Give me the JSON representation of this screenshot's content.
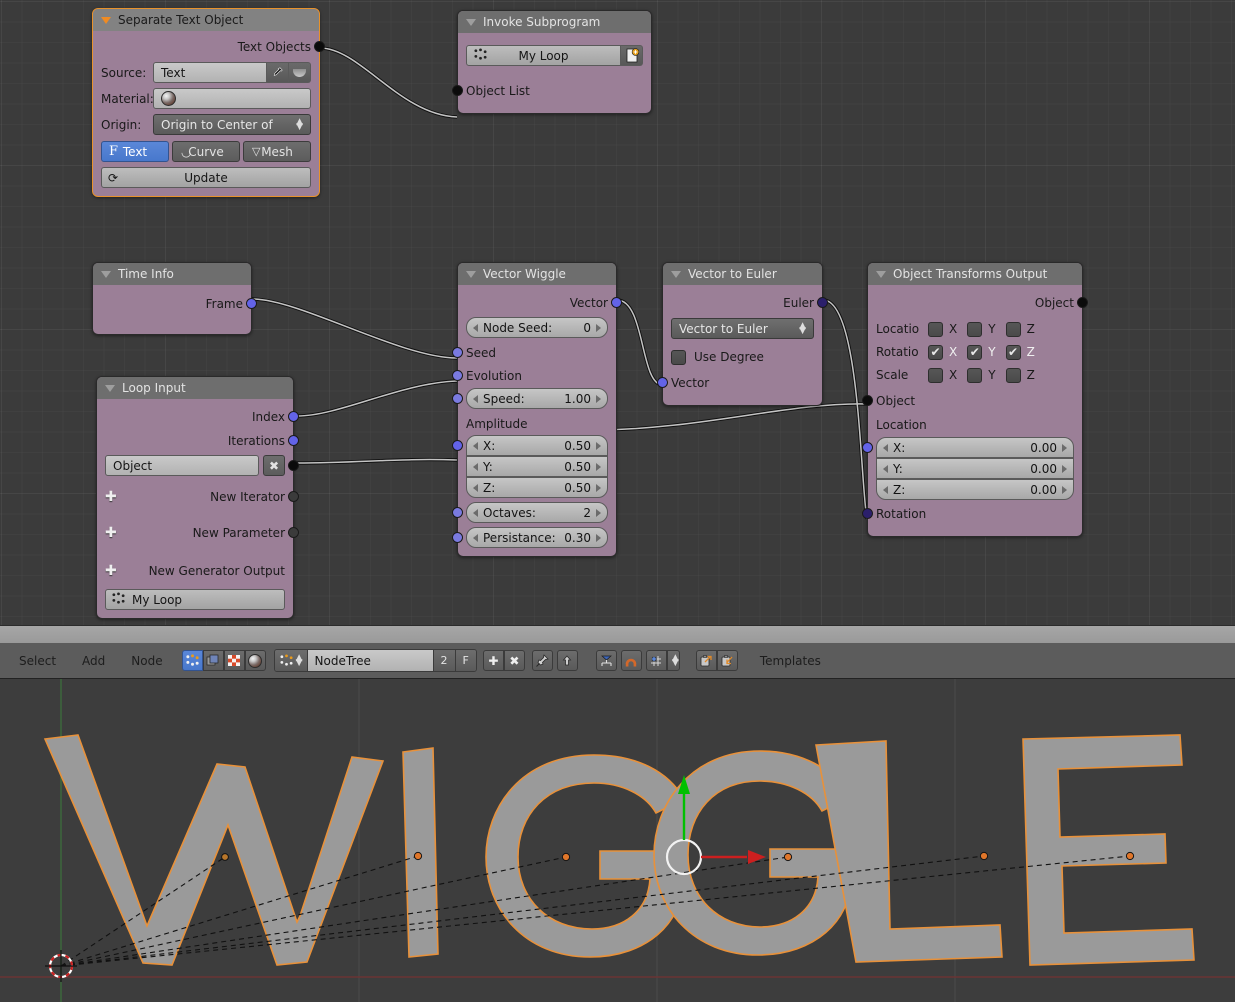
{
  "app": {
    "editor": "node-editor",
    "viewport": "3d-viewport"
  },
  "nodes": {
    "separate_text": {
      "title": "Separate Text Object",
      "output_label": "Text Objects",
      "source_label": "Source:",
      "source_value": "Text",
      "material_label": "Material:",
      "origin_label": "Origin:",
      "origin_value": "Origin to Center of",
      "mode_text": "Text",
      "mode_curve": "Curve",
      "mode_mesh": "Mesh",
      "update_label": "Update",
      "active": true
    },
    "invoke_subprogram": {
      "title": "Invoke Subprogram",
      "subprogram": "My Loop",
      "input_label": "Object List"
    },
    "time_info": {
      "title": "Time Info",
      "output_label": "Frame"
    },
    "loop_input": {
      "title": "Loop Input",
      "index_label": "Index",
      "iterations_label": "Iterations",
      "object_field": "Object",
      "new_iterator_label": "New Iterator",
      "new_parameter_label": "New Parameter",
      "new_generator_label": "New Generator Output",
      "subprogram": "My Loop"
    },
    "vector_wiggle": {
      "title": "Vector Wiggle",
      "output_label": "Vector",
      "node_seed_label": "Node Seed:",
      "node_seed_value": "0",
      "seed_label": "Seed",
      "evolution_label": "Evolution",
      "speed_label": "Speed:",
      "speed_value": "1.00",
      "amplitude_label": "Amplitude",
      "amp_x_label": "X:",
      "amp_x_value": "0.50",
      "amp_y_label": "Y:",
      "amp_y_value": "0.50",
      "amp_z_label": "Z:",
      "amp_z_value": "0.50",
      "octaves_label": "Octaves:",
      "octaves_value": "2",
      "persistance_label": "Persistance:",
      "persistance_value": "0.30"
    },
    "vector_to_euler": {
      "title": "Vector to Euler",
      "output_label": "Euler",
      "mode_value": "Vector to Euler",
      "use_degree_label": "Use Degree",
      "use_degree_checked": false,
      "input_label": "Vector"
    },
    "object_transforms_output": {
      "title": "Object Transforms Output",
      "output_label": "Object",
      "location_row_label": "Locatio",
      "rotation_row_label": "Rotatio",
      "scale_row_label": "Scale",
      "axis_x": "X",
      "axis_y": "Y",
      "axis_z": "Z",
      "loc_checks": [
        false,
        false,
        false
      ],
      "rot_checks": [
        true,
        true,
        true
      ],
      "scale_checks": [
        false,
        false,
        false
      ],
      "object_input_label": "Object",
      "location_label": "Location",
      "loc_x_label": "X:",
      "loc_x_value": "0.00",
      "loc_y_label": "Y:",
      "loc_y_value": "0.00",
      "loc_z_label": "Z:",
      "loc_z_value": "0.00",
      "rotation_input_label": "Rotation"
    }
  },
  "header": {
    "menus": [
      "Select",
      "Add",
      "Node"
    ],
    "icons": [
      "node-select-icon",
      "node-copy-icon",
      "node-overlay-icon",
      "node-shading-icon"
    ],
    "id_icon": "nodetree-icon",
    "id_name": "NodeTree",
    "users_count": "2",
    "fake_user": "F",
    "new_icon": "plus-icon",
    "unlink_icon": "cross-icon",
    "pin_icon": "pin-icon",
    "parent_icon": "up-arrow-icon",
    "tool_icons": [
      "auto-offset-icon",
      "snap-magnet-icon",
      "snap-grid-icon"
    ],
    "io_icons": [
      "export-icon",
      "import-icon"
    ],
    "templates_label": "Templates"
  },
  "viewport": {
    "text": "WIGGLE",
    "letters": [
      "W",
      "I",
      "G",
      "G",
      "L",
      "E"
    ],
    "selection_color": "#e8913a",
    "object_color": "#9a9a9a",
    "z_axis_color": "#00c000",
    "x_axis_color": "#c1392b",
    "cursor": "3d-cursor",
    "manipulator": "translate-manipulator"
  },
  "colors": {
    "node_body": "#9b7f97",
    "node_header": "#6e6e6e",
    "active_border": "#e8922b",
    "editor_bg": "#3b3b3b",
    "socket_blue": "#6363e8",
    "socket_black": "#0b0b0b"
  }
}
